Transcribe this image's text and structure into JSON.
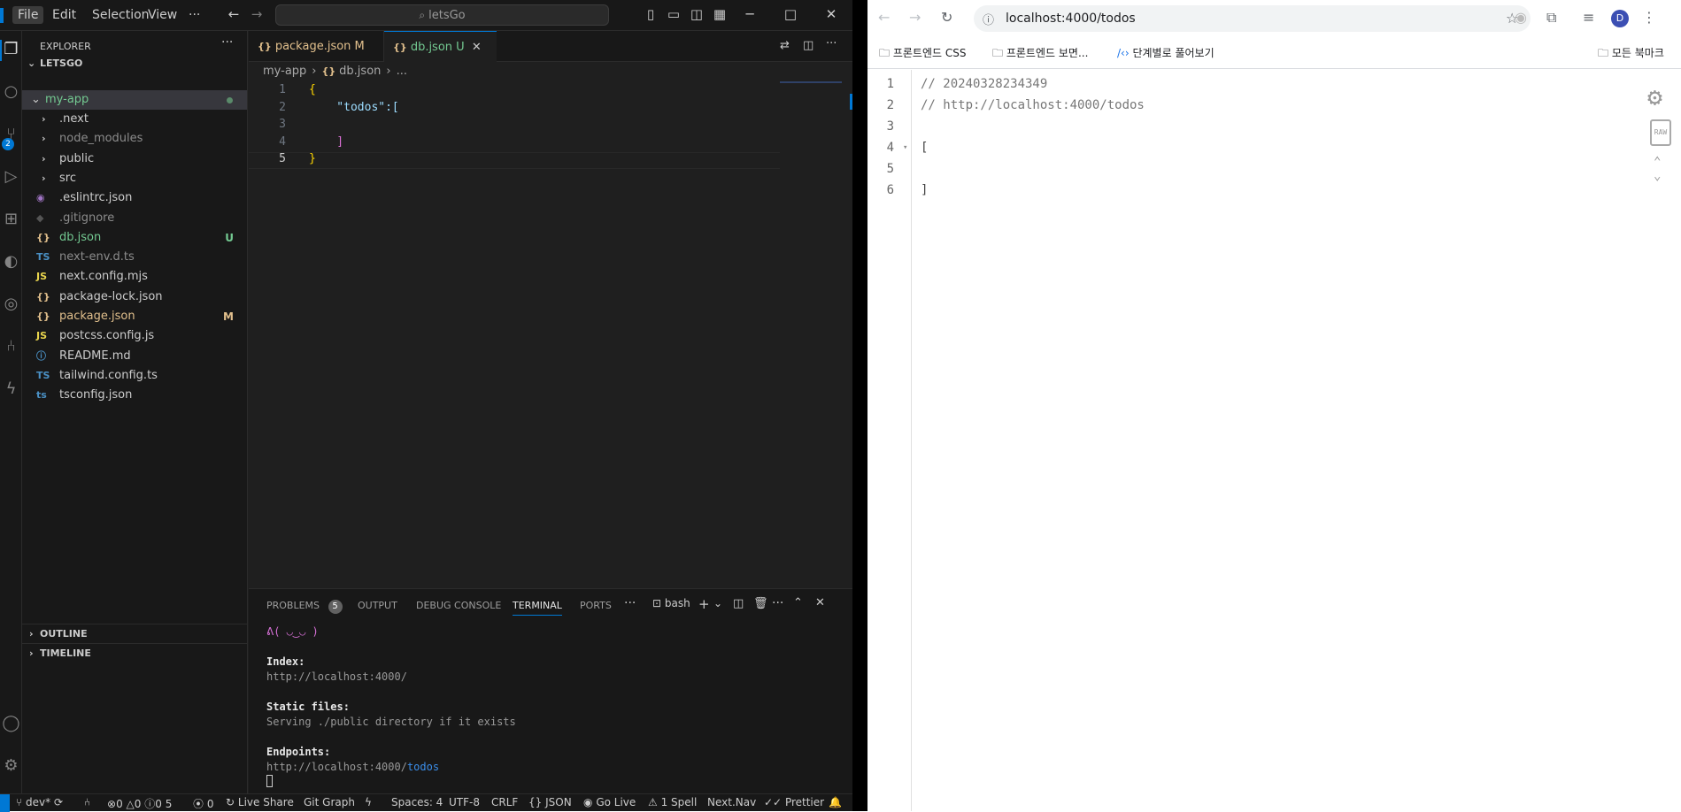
{
  "vscode": {
    "menu": [
      "File",
      "Edit",
      "Selection",
      "View",
      "···"
    ],
    "search_label": "letsGo",
    "explorer_title": "EXPLORER",
    "workspace": "LETSGO",
    "root_folder": "my-app",
    "tree": [
      {
        "label": ".next",
        "icon": "folder-chevron",
        "status": ""
      },
      {
        "label": "node_modules",
        "icon": "folder-chevron",
        "status": ""
      },
      {
        "label": "public",
        "icon": "folder-chevron",
        "status": ""
      },
      {
        "label": "src",
        "icon": "folder-chevron",
        "status": ""
      },
      {
        "label": ".eslintrc.json",
        "icon": "eslint-icon",
        "status": ""
      },
      {
        "label": ".gitignore",
        "icon": "git-icon",
        "status": ""
      },
      {
        "label": "db.json",
        "icon": "json-icon",
        "status": "U"
      },
      {
        "label": "next-env.d.ts",
        "icon": "ts-icon",
        "status": ""
      },
      {
        "label": "next.config.mjs",
        "icon": "js-icon",
        "status": ""
      },
      {
        "label": "package-lock.json",
        "icon": "json-icon",
        "status": ""
      },
      {
        "label": "package.json",
        "icon": "json-icon",
        "status": "M"
      },
      {
        "label": "postcss.config.js",
        "icon": "js-icon",
        "status": ""
      },
      {
        "label": "README.md",
        "icon": "info-icon",
        "status": ""
      },
      {
        "label": "tailwind.config.ts",
        "icon": "ts-icon",
        "status": ""
      },
      {
        "label": "tsconfig.json",
        "icon": "tsconfig-icon",
        "status": ""
      }
    ],
    "outline": "OUTLINE",
    "timeline": "TIMELINE",
    "tabs": [
      {
        "label": "package.json",
        "status": "M"
      },
      {
        "label": "db.json",
        "status": "U"
      }
    ],
    "breadcrumb": [
      "my-app",
      "db.json",
      "..."
    ],
    "code_lines": [
      {
        "num": "1",
        "text": "{"
      },
      {
        "num": "2",
        "text": "    \"todos\":["
      },
      {
        "num": "3",
        "text": ""
      },
      {
        "num": "4",
        "text": "    ]"
      },
      {
        "num": "5",
        "text": "}"
      }
    ],
    "panel_tabs": [
      "PROBLEMS",
      "OUTPUT",
      "DEBUG CONSOLE",
      "TERMINAL",
      "PORTS"
    ],
    "problems_count": "5",
    "terminal_shell": "bash",
    "terminal": {
      "face": "ᕕ( ◡‿◡ )",
      "index_label": "Index:",
      "index_url": "http://localhost:4000/",
      "static_label": "Static files:",
      "static_text": "Serving ./public directory if it exists",
      "endpoints_label": "Endpoints:",
      "endpoint_base": "http://localhost:4000/",
      "endpoint_path": "todos"
    },
    "status": {
      "branch": "dev*",
      "errors": "0",
      "warnings": "0",
      "info": "0",
      "count5": "5",
      "ports": "0",
      "live_share": "Live Share",
      "git_graph": "Git Graph",
      "spaces": "Spaces: 4",
      "encoding": "UTF-8",
      "eol": "CRLF",
      "language": "JSON",
      "go_live": "Go Live",
      "spell": "1 Spell",
      "next_nav": "Next.Nav",
      "prettier": "Prettier"
    },
    "colors": {
      "accent": "#0078d4",
      "modified": "#e2c08d",
      "untracked": "#73c991"
    }
  },
  "browser": {
    "url": "localhost:4000/todos",
    "bookmarks": [
      "프론트엔드 CSS",
      "프론트엔드 보면...",
      "단계별로 풀어보기",
      "모든 북마크"
    ],
    "profile_initial": "D",
    "json_lines": [
      {
        "num": "1",
        "text": "// 20240328234349"
      },
      {
        "num": "2",
        "text": "// http://localhost:4000/todos"
      },
      {
        "num": "3",
        "text": ""
      },
      {
        "num": "4",
        "text": "["
      },
      {
        "num": "5",
        "text": ""
      },
      {
        "num": "6",
        "text": "]"
      }
    ],
    "raw_label": "RAW"
  }
}
